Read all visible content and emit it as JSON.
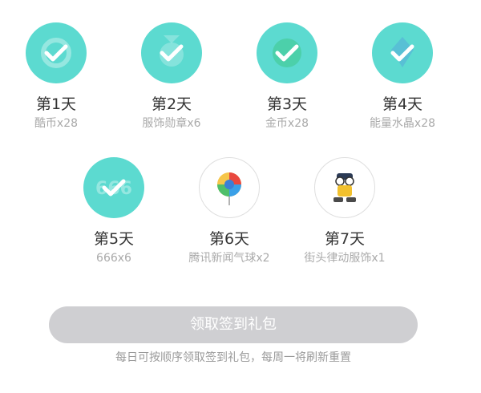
{
  "days": [
    {
      "label": "第1天",
      "reward": "酷币x28",
      "icon": "coolcoin-icon",
      "status": "claimed"
    },
    {
      "label": "第2天",
      "reward": "服饰勋章x6",
      "icon": "medal-icon",
      "status": "claimed"
    },
    {
      "label": "第3天",
      "reward": "金币x28",
      "icon": "gold-coin-icon",
      "status": "claimed"
    },
    {
      "label": "第4天",
      "reward": "能量水晶x28",
      "icon": "energy-crystal-icon",
      "status": "claimed"
    },
    {
      "label": "第5天",
      "reward": "666x6",
      "icon": "666-icon",
      "status": "claimed"
    },
    {
      "label": "第6天",
      "reward": "腾讯新闻气球x2",
      "icon": "tencent-news-balloon-icon",
      "status": "pending"
    },
    {
      "label": "第7天",
      "reward": "街头律动服饰x1",
      "icon": "street-rhythm-outfit-icon",
      "status": "pending"
    }
  ],
  "claim_button": {
    "label": "领取签到礼包",
    "state": "disabled"
  },
  "note": "每日可按顺序领取签到礼包，每周一将刷新重置",
  "colors": {
    "claimed_circle": "#5cdad0",
    "check": "#ffffff",
    "button_disabled": "#cfcfd2",
    "day_text": "#333333",
    "reward_text": "#aaaaaa",
    "note_text": "#9a9a9a"
  }
}
